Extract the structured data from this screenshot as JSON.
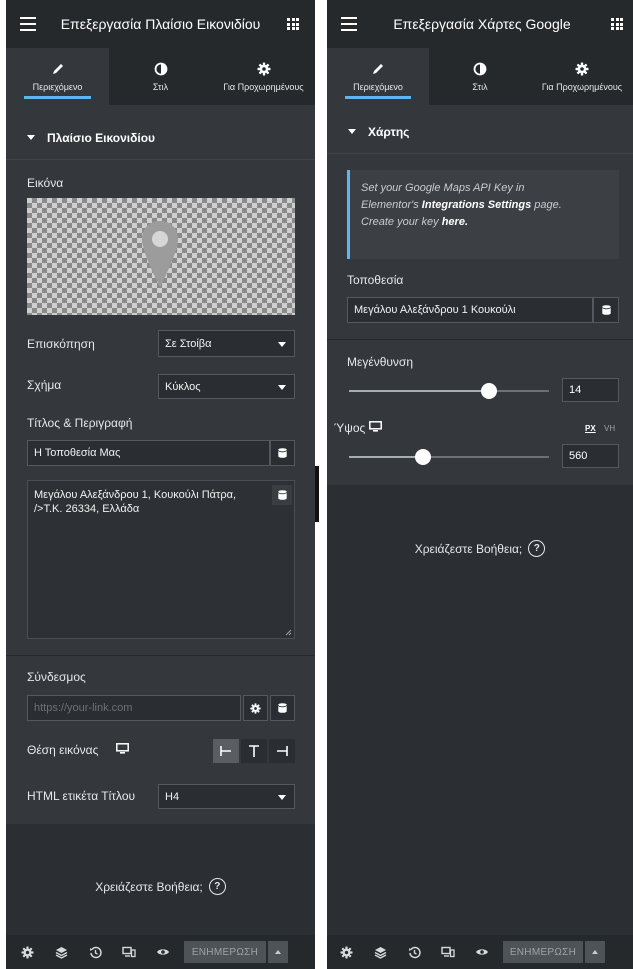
{
  "left_panel": {
    "header_title": "Επεξεργασία Πλαίσιο Εικονιδίου",
    "tabs": [
      {
        "label": "Περιεχόμενο",
        "icon": "pencil-icon"
      },
      {
        "label": "Στιλ",
        "icon": "half-circle-icon"
      },
      {
        "label": "Για Προχωρημένους",
        "icon": "gear-icon"
      }
    ],
    "section_title": "Πλαίσιο Εικονιδίου",
    "image_label": "Εικόνα",
    "view_label": "Επισκόπηση",
    "view_value": "Σε Στοίβα",
    "shape_label": "Σχήμα",
    "shape_value": "Κύκλος",
    "title_desc_label": "Τίτλος & Περιγραφή",
    "title_value": "Η Τοποθεσία Μας",
    "description_value": "Μεγάλου Αλεξάνδρου 1, Κουκούλι Πάτρα, />Τ.Κ. 26334, Ελλάδα",
    "link_label": "Σύνδεσμος",
    "link_placeholder": "https://your-link.com",
    "image_position_label": "Θέση εικόνας",
    "html_tag_label": "HTML ετικέτα Τίτλου",
    "html_tag_value": "H4",
    "help_text": "Χρειάζεστε Βοήθεια;",
    "update_label": "ΕΝΗΜΕΡΩΣΗ"
  },
  "right_panel": {
    "header_title": "Επεξεργασία Χάρτες Google",
    "tabs": [
      {
        "label": "Περιεχόμενο",
        "icon": "pencil-icon"
      },
      {
        "label": "Στιλ",
        "icon": "half-circle-icon"
      },
      {
        "label": "Για Προχωρημένους",
        "icon": "gear-icon"
      }
    ],
    "section_title": "Χάρτης",
    "note": {
      "line1": "Set your Google Maps API Key in",
      "line2_pre": "Elementor's ",
      "line2_bold": "Integrations Settings",
      "line2_post": " page.",
      "line3_pre": "Create your key ",
      "line3_link": "here."
    },
    "location_label": "Τοποθεσία",
    "location_value": "Μεγάλου Αλεξάνδρου 1 Κουκούλι",
    "zoom_label": "Μεγένθυνση",
    "zoom_value": "14",
    "zoom_fraction": 0.7,
    "height_label": "Ύψος",
    "unit_px": "PX",
    "unit_vh": "VH",
    "height_value": "560",
    "height_fraction": 0.37,
    "help_text": "Χρειάζεστε Βοήθεια;",
    "update_label": "ΕΝΗΜΕΡΩΣΗ"
  },
  "colors": {
    "panel_bg": "#34383c",
    "header_bg": "#26292c",
    "accent": "#5fb6ef"
  }
}
